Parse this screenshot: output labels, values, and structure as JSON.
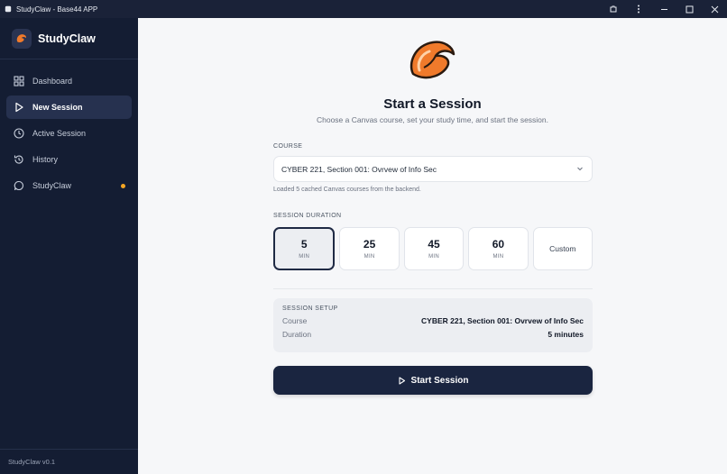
{
  "window": {
    "title": "StudyClaw - Base44 APP"
  },
  "sidebar": {
    "brand": "StudyClaw",
    "items": [
      {
        "label": "Dashboard",
        "icon": "grid-icon"
      },
      {
        "label": "New Session",
        "icon": "play-icon"
      },
      {
        "label": "Active Session",
        "icon": "clock-icon"
      },
      {
        "label": "History",
        "icon": "history-icon"
      },
      {
        "label": "StudyClaw",
        "icon": "chat-icon"
      }
    ],
    "active_index": 1,
    "notification_color": "#f5a623",
    "version": "StudyClaw v0.1"
  },
  "main": {
    "title": "Start a Session",
    "subtitle": "Choose a Canvas course, set your study time, and start the session.",
    "course": {
      "label": "COURSE",
      "selected": "CYBER 221, Section 001: Ovrvew of Info Sec",
      "hint": "Loaded 5 cached Canvas courses from the backend."
    },
    "duration": {
      "label": "SESSION DURATION",
      "options": [
        {
          "value": "5",
          "unit": "MIN"
        },
        {
          "value": "25",
          "unit": "MIN"
        },
        {
          "value": "45",
          "unit": "MIN"
        },
        {
          "value": "60",
          "unit": "MIN"
        }
      ],
      "custom_label": "Custom",
      "selected_index": 0
    },
    "setup": {
      "label": "SESSION SETUP",
      "course_key": "Course",
      "course_value": "CYBER 221, Section 001: Ovrvew of Info Sec",
      "duration_key": "Duration",
      "duration_value": "5 minutes"
    },
    "start_label": "Start Session"
  },
  "colors": {
    "sidebar_bg": "#141d33",
    "accent_orange": "#f07a2b",
    "button_bg": "#1a2540"
  }
}
